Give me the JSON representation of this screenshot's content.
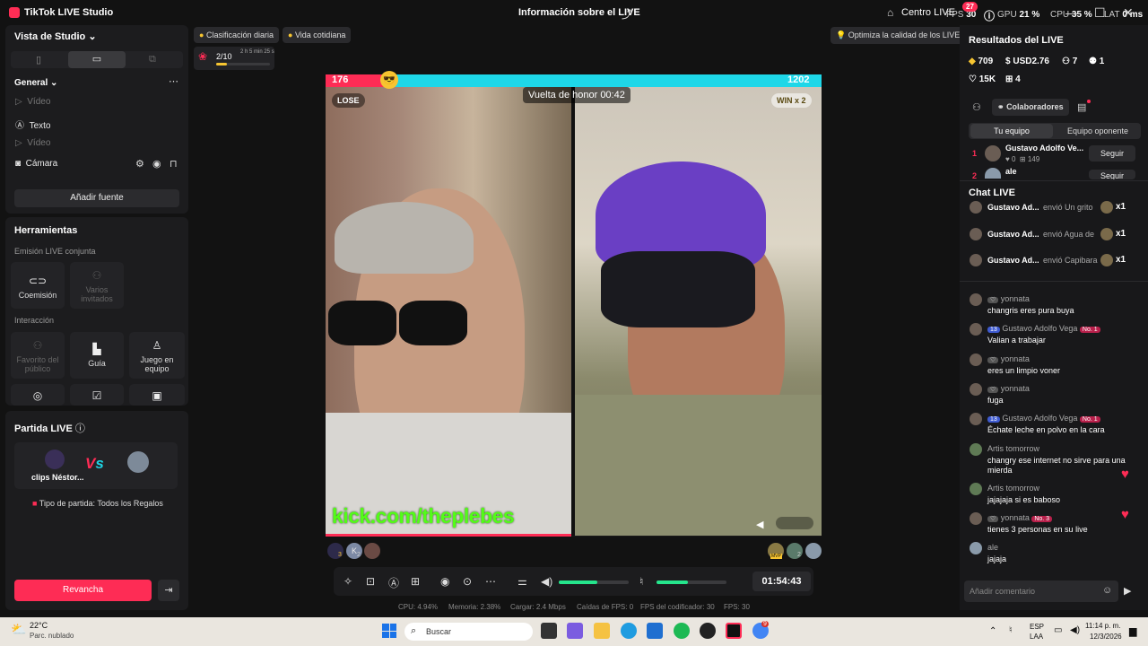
{
  "titlebar": {
    "app": "TikTok LIVE Studio",
    "center": "Información sobre el LIVE",
    "centro_live": "Centro LIVE",
    "fps_label": "FPS",
    "fps_value": "30",
    "fps_badge": "27",
    "gpu_label": "GPU",
    "gpu_value": "21 %",
    "cpu_label": "CPU",
    "cpu_value": "35 %",
    "lat_label": "LAT",
    "lat_value": "0 ms"
  },
  "top_chips": {
    "ranking": "Clasificación diaria",
    "category": "Vida cotidiana",
    "optimize": "Optimiza la calidad de los LIVE",
    "progress": "2/10",
    "progress_time": "2 h 5 min 25 s",
    "progress_fill": 0.2
  },
  "studio": {
    "title": "Vista de Studio",
    "general": "General",
    "sources": [
      {
        "label": "Vídeo",
        "enabled": false
      },
      {
        "label": "Texto",
        "enabled": true
      },
      {
        "label": "Vídeo",
        "enabled": false
      },
      {
        "label": "Cámara",
        "enabled": true
      }
    ],
    "add_source": "Añadir fuente"
  },
  "tools": {
    "title": "Herramientas",
    "co_section": "Emisión LIVE conjunta",
    "co_host": "Coemisión",
    "multi_guest": "Varios invitados",
    "interaction": "Interacción",
    "fav": "Favorito del público",
    "guide": "Guía",
    "team_game": "Juego en equipo"
  },
  "match": {
    "title": "Partida LIVE",
    "player": "clips Néstor...",
    "type": "Tipo de partida: Todos los Regalos",
    "rematch": "Revancha"
  },
  "stage": {
    "score_left": "176",
    "score_right": "1202",
    "score_left_share": 0.13,
    "lose": "LOSE",
    "win": "WIN",
    "win_mult": "x 2",
    "honor": "Vuelta de honor 00:42",
    "watermark": "kick.com/theplebes",
    "left_count": "3",
    "left_count2": "2",
    "right_count": "2",
    "mvp": "MVP"
  },
  "controls": {
    "timer": "01:54:43",
    "volume": 0.55,
    "mic": 0.45
  },
  "status": {
    "cpu_label": "CPU:",
    "cpu": "4.94%",
    "mem_label": "Memoria:",
    "mem": "2.38%",
    "load_label": "Cargar:",
    "load": "2.4 Mbps",
    "drops_label": "Caídas de FPS:",
    "drops": "0",
    "enc_label": "FPS del codificador:",
    "enc": "30",
    "fps_label": "FPS:",
    "fps": "30"
  },
  "results": {
    "title": "Resultados del LIVE",
    "coins": "709",
    "usd": "USD2.76",
    "followers": "7",
    "shares": "1",
    "likes": "15K",
    "gifts": "4",
    "collab": "Colaboradores",
    "tab_mine": "Tu equipo",
    "tab_opp": "Equipo oponente",
    "team": [
      {
        "rank": "1",
        "name": "Gustavo Adolfo Ve...",
        "hearts": "0",
        "pts": "149",
        "action": "Seguir"
      },
      {
        "rank": "2",
        "name": "ale",
        "action": "Seguir"
      }
    ]
  },
  "chat": {
    "title": "Chat LIVE",
    "placeholder": "Añadir comentario",
    "gifts": [
      {
        "name": "Gustavo Ad...",
        "text": "envió Un grito",
        "count": "x1"
      },
      {
        "name": "Gustavo Ad...",
        "text": "envió Agua de",
        "count": "x1"
      },
      {
        "name": "Gustavo Ad...",
        "text": "envió Capibara",
        "count": "x1"
      }
    ],
    "messages": [
      {
        "name": "yonnata",
        "msg": "changris eres pura buya"
      },
      {
        "name": "Gustavo Adolfo Vega",
        "level": "13",
        "rank": "No. 1",
        "msg": "Valian a trabajar"
      },
      {
        "name": "yonnata",
        "msg": "eres un limpio voner"
      },
      {
        "name": "yonnata",
        "msg": "fuga"
      },
      {
        "name": "Gustavo Adolfo Vega",
        "level": "13",
        "rank": "No. 1",
        "msg": "Échate leche en polvo en la cara"
      },
      {
        "name": "Artis tomorrow",
        "msg": "changry ese internet no sirve para una mierda"
      },
      {
        "name": "Artis tomorrow",
        "msg": "jajajaja si es baboso"
      },
      {
        "name": "yonnata",
        "rank": "No. 3",
        "msg": "tienes 3 personas en su live"
      },
      {
        "name": "ale",
        "msg": "jajaja"
      }
    ]
  },
  "taskbar": {
    "temp": "22°C",
    "weather": "Parc. nublado",
    "search": "Buscar",
    "lang1": "ESP",
    "lang2": "LAA",
    "time": "11:14 p. m.",
    "date": "12/3/2026",
    "badge": "9"
  },
  "colors": {
    "accent": "#fe2c55",
    "cyan": "#1ed7e8",
    "green": "#25e58c",
    "kick": "#53fc18"
  }
}
